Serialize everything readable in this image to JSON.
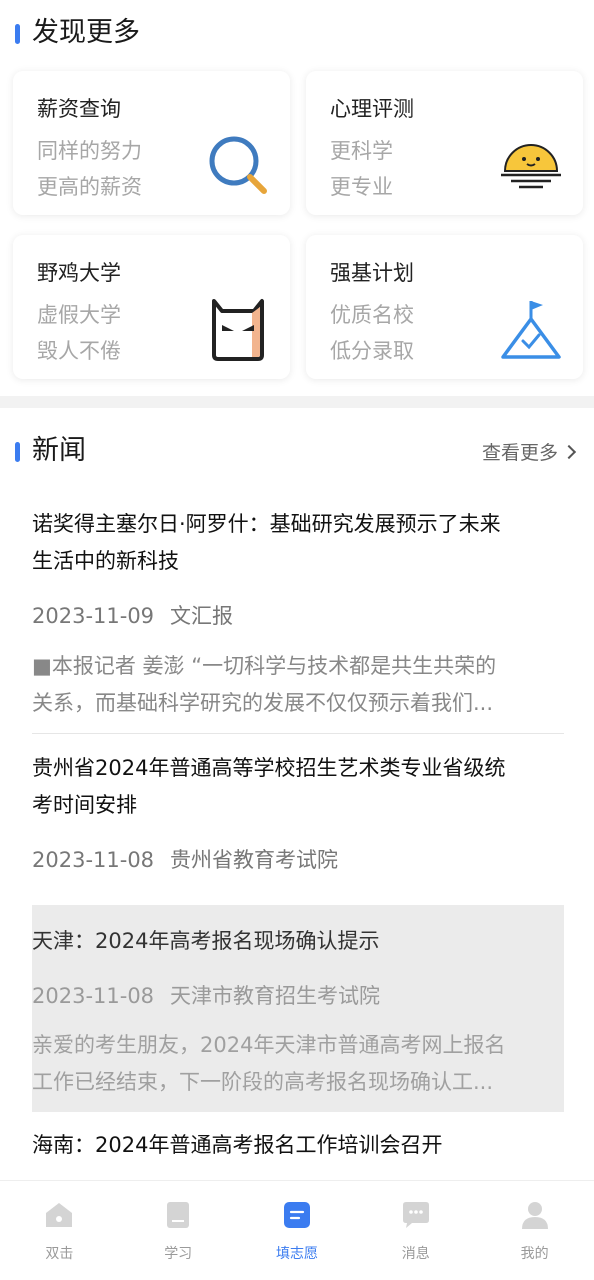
{
  "discover": {
    "title": "发现更多",
    "cards": [
      {
        "title": "薪资查询",
        "line1": "同样的努力",
        "line2": "更高的薪资",
        "icon": "magnifier-icon"
      },
      {
        "title": "心理评测",
        "line1": "更科学",
        "line2": "更专业",
        "icon": "sunrise-icon"
      },
      {
        "title": "野鸡大学",
        "line1": "虚假大学",
        "line2": "毁人不倦",
        "icon": "devil-face-icon"
      },
      {
        "title": "强基计划",
        "line1": "优质名校",
        "line2": "低分录取",
        "icon": "mountain-flag-icon"
      }
    ]
  },
  "news": {
    "title": "新闻",
    "more_label": "查看更多",
    "items": [
      {
        "title_l1": "诺奖得主塞尔日·阿罗什：基础研究发展预示了未来",
        "title_l2": "生活中的新科技",
        "date": "2023-11-09",
        "source": "文汇报",
        "summary_l1": "■本报记者 姜澎 “一切科学与技术都是共生共荣的",
        "summary_l2": "关系，而基础科学研究的发展不仅仅预示着我们..."
      },
      {
        "title_l1": "贵州省2024年普通高等学校招生艺术类专业省级统",
        "title_l2": "考时间安排",
        "date": "2023-11-08",
        "source": "贵州省教育考试院"
      },
      {
        "title_l1": "天津：2024年高考报名现场确认提示",
        "date": "2023-11-08",
        "source": "天津市教育招生考试院",
        "summary_l1": "亲爱的考生朋友，2024年天津市普通高考网上报名",
        "summary_l2": "工作已经结束，下一阶段的高考报名现场确认工..."
      },
      {
        "title_l1": "海南：2024年普通高考报名工作培训会召开"
      }
    ]
  },
  "tabbar": {
    "items": [
      {
        "label": "双击",
        "icon": "home-icon"
      },
      {
        "label": "学习",
        "icon": "book-icon"
      },
      {
        "label": "填志愿",
        "icon": "form-icon",
        "active": true
      },
      {
        "label": "消息",
        "icon": "message-icon"
      },
      {
        "label": "我的",
        "icon": "user-icon"
      }
    ]
  },
  "colors": {
    "accent": "#3b7cf0",
    "highlight_bg": "#ebebeb"
  }
}
